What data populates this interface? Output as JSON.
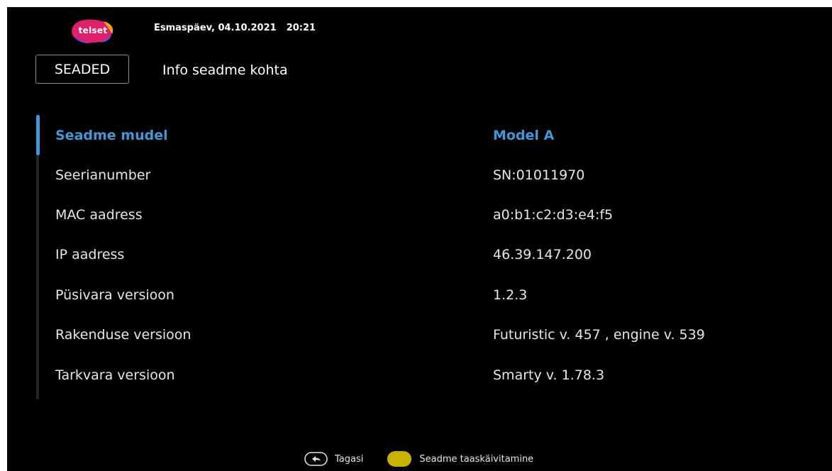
{
  "header": {
    "logo_text": "telset",
    "date": "Esmaspäev, 04.10.2021",
    "time": "20:21",
    "section": "SEADED",
    "title": "Info seadme kohta"
  },
  "rows": [
    {
      "label": "Seadme mudel",
      "value": "Model A",
      "selected": true
    },
    {
      "label": "Seerianumber",
      "value": "SN:01011970"
    },
    {
      "label": "MAC aadress",
      "value": "a0:b1:c2:d3:e4:f5"
    },
    {
      "label": "IP aadress",
      "value": "46.39.147.200"
    },
    {
      "label": "Püsivara versioon",
      "value": "1.2.3"
    },
    {
      "label": "Rakenduse versioon",
      "value": "Futuristic v. 457 , engine v. 539"
    },
    {
      "label": "Tarkvara versioon",
      "value": "Smarty v. 1.78.3"
    }
  ],
  "footer": {
    "back_label": "Tagasi",
    "back_icon": "back-arrow-icon",
    "yellow_label": "Seadme taaskäivitamine",
    "yellow_color": "#c9b300"
  },
  "colors": {
    "accent": "#3f98d8",
    "background": "#000000",
    "text": "#e6e6e6"
  }
}
